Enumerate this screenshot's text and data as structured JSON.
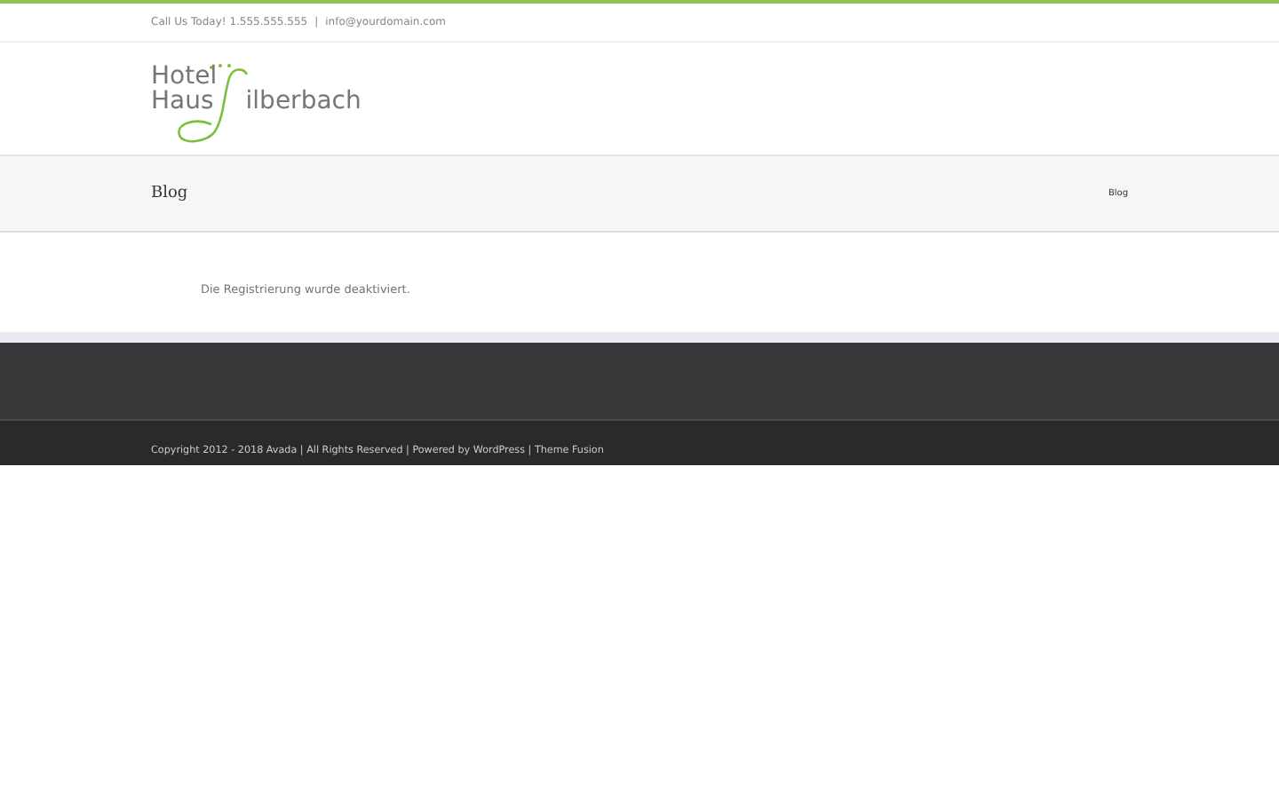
{
  "top_bar": {
    "phone": "Call Us Today! 1.555.555.555",
    "separator": "|",
    "email": "info@yourdomain.com"
  },
  "logo": {
    "line1": "Hotel",
    "line2_start": "Haus",
    "line2_end": "ilberbach"
  },
  "page_title_bar": {
    "title": "Blog",
    "breadcrumb": "Blog"
  },
  "content": {
    "message": "Die Registrierung wurde deaktiviert."
  },
  "footer": {
    "copyright": "Copyright 2012 - 2018 Avada | All Rights Reserved | Powered by WordPress | Theme Fusion"
  }
}
